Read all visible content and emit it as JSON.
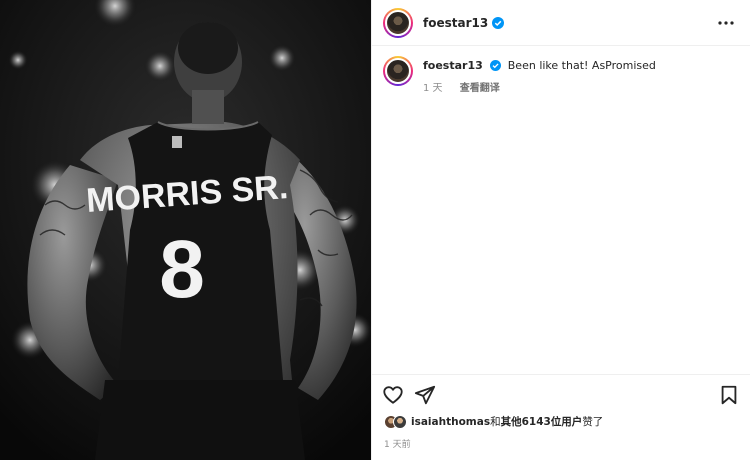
{
  "post": {
    "image_alt": "Black-and-white photo of a basketball player seen from behind wearing jersey MORRIS SR. number 8",
    "jersey_name": "MORRIS SR.",
    "jersey_number": "8"
  },
  "header": {
    "username": "foestar13"
  },
  "caption": {
    "username": "foestar13",
    "text": "Been like that! AsPromised",
    "time": "1 天",
    "translate": "查看翻译"
  },
  "likes": {
    "user": "isaiahthomas",
    "joiner": "和",
    "others": "其他6143位用户",
    "suffix": "赞了"
  },
  "date": "1 天前",
  "icons": [
    "heart-icon",
    "share-icon",
    "bookmark-icon",
    "more-icon",
    "verified-icon"
  ],
  "colors": {
    "verified": "#0095f6",
    "muted": "#8e8e8e"
  }
}
